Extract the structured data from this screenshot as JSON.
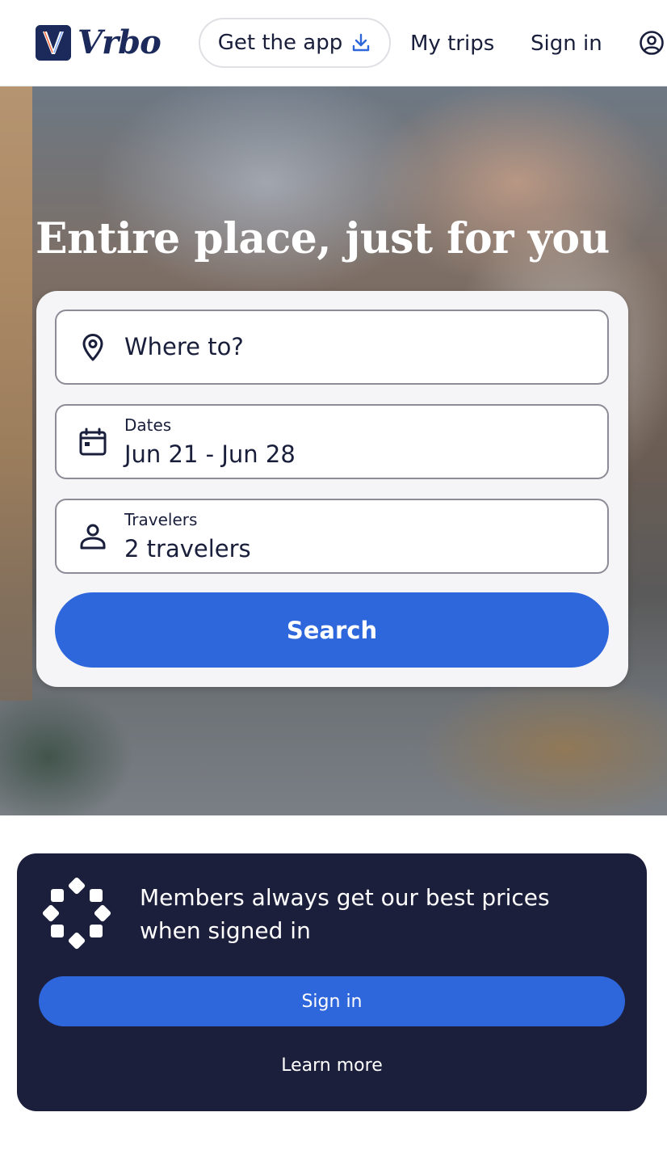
{
  "header": {
    "logo_text": "Vrbo",
    "get_app_label": "Get the app",
    "nav": [
      {
        "label": "My trips"
      },
      {
        "label": "Sign in"
      }
    ],
    "icons": [
      "download-icon",
      "account-icon"
    ]
  },
  "hero": {
    "title": "Entire place, just for you"
  },
  "search": {
    "destination_placeholder": "Where to?",
    "dates_label": "Dates",
    "dates_value": "Jun 21 - Jun 28",
    "travelers_label": "Travelers",
    "travelers_value": "2 travelers",
    "search_button": "Search",
    "icons": [
      "map-pin-icon",
      "calendar-icon",
      "person-icon"
    ]
  },
  "members": {
    "message": "Members always get our best prices when signed in",
    "sign_in_button": "Sign in",
    "learn_more_link": "Learn more",
    "icon": "members-diamond-ring-icon"
  },
  "colors": {
    "primary": "#2e66dc",
    "navy": "#1c1f3c",
    "text": "#191e3b"
  }
}
